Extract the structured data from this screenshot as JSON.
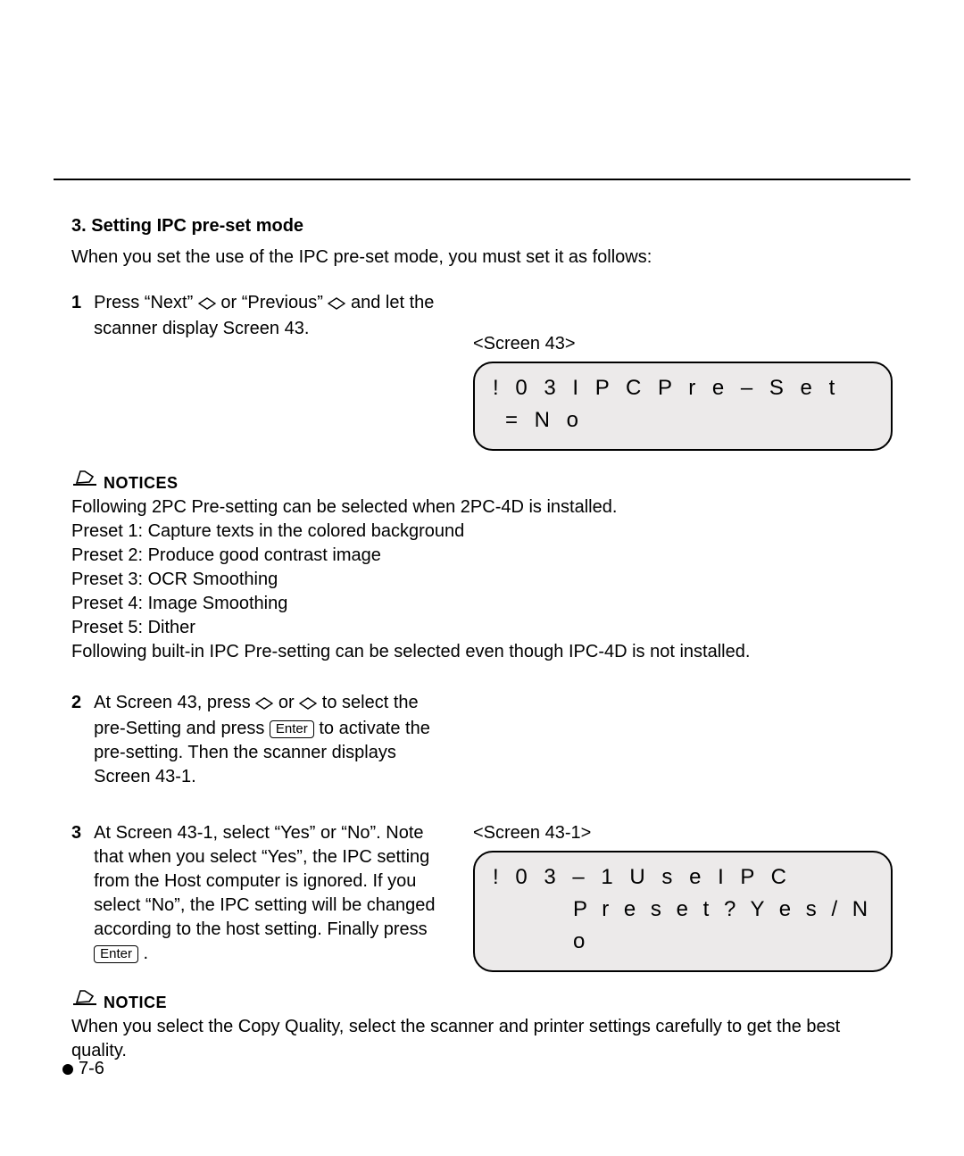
{
  "section": {
    "title": "3. Setting IPC pre-set mode",
    "intro": "When you set the use of the IPC pre-set mode, you must set it as follows:"
  },
  "steps": {
    "s1": {
      "num": "1",
      "text_a": "Press “Next” ",
      "text_b": " or “Previous” ",
      "text_c": " and let the scanner display Screen 43."
    },
    "s2": {
      "num": "2",
      "text_a": "At Screen 43, press ",
      "text_b": " or ",
      "text_c": " to select the pre-Setting and press ",
      "text_d": " to activate the pre-setting. Then the scanner displays Screen 43-1."
    },
    "s3": {
      "num": "3",
      "text_a": "At Screen 43-1, select “Yes” or “No”. Note that when you select “Yes”, the IPC setting from the Host computer is ignored.  If you select “No”, the IPC setting will be changed according to the host setting. Finally press ",
      "text_b": " ."
    }
  },
  "screens": {
    "a": {
      "label": "<Screen 43>",
      "line1": "! 0 3   I P C   P r e – S e t",
      "line2": "= N o"
    },
    "b": {
      "label": "<Screen 43-1>",
      "line1": "! 0 3 – 1   U s e   I P C",
      "line2": "P r e s e t ?   Y e s / N o"
    }
  },
  "notices": {
    "first": {
      "label": "NOTICES",
      "l1": "Following 2PC Pre-setting can be selected when 2PC-4D is installed.",
      "l2": "Preset 1: Capture texts in the colored background",
      "l3": "Preset 2: Produce good contrast image",
      "l4": "Preset 3: OCR Smoothing",
      "l5": "Preset 4: Image Smoothing",
      "l6": "Preset 5: Dither",
      "l7": "Following built-in IPC Pre-setting can be selected even though IPC-4D is not installed."
    },
    "second": {
      "label": "NOTICE",
      "body": "When you select the Copy Quality, select the scanner and printer settings carefully to get the best quality."
    }
  },
  "key": {
    "enter": "Enter"
  },
  "footer": {
    "page": "7-6"
  }
}
